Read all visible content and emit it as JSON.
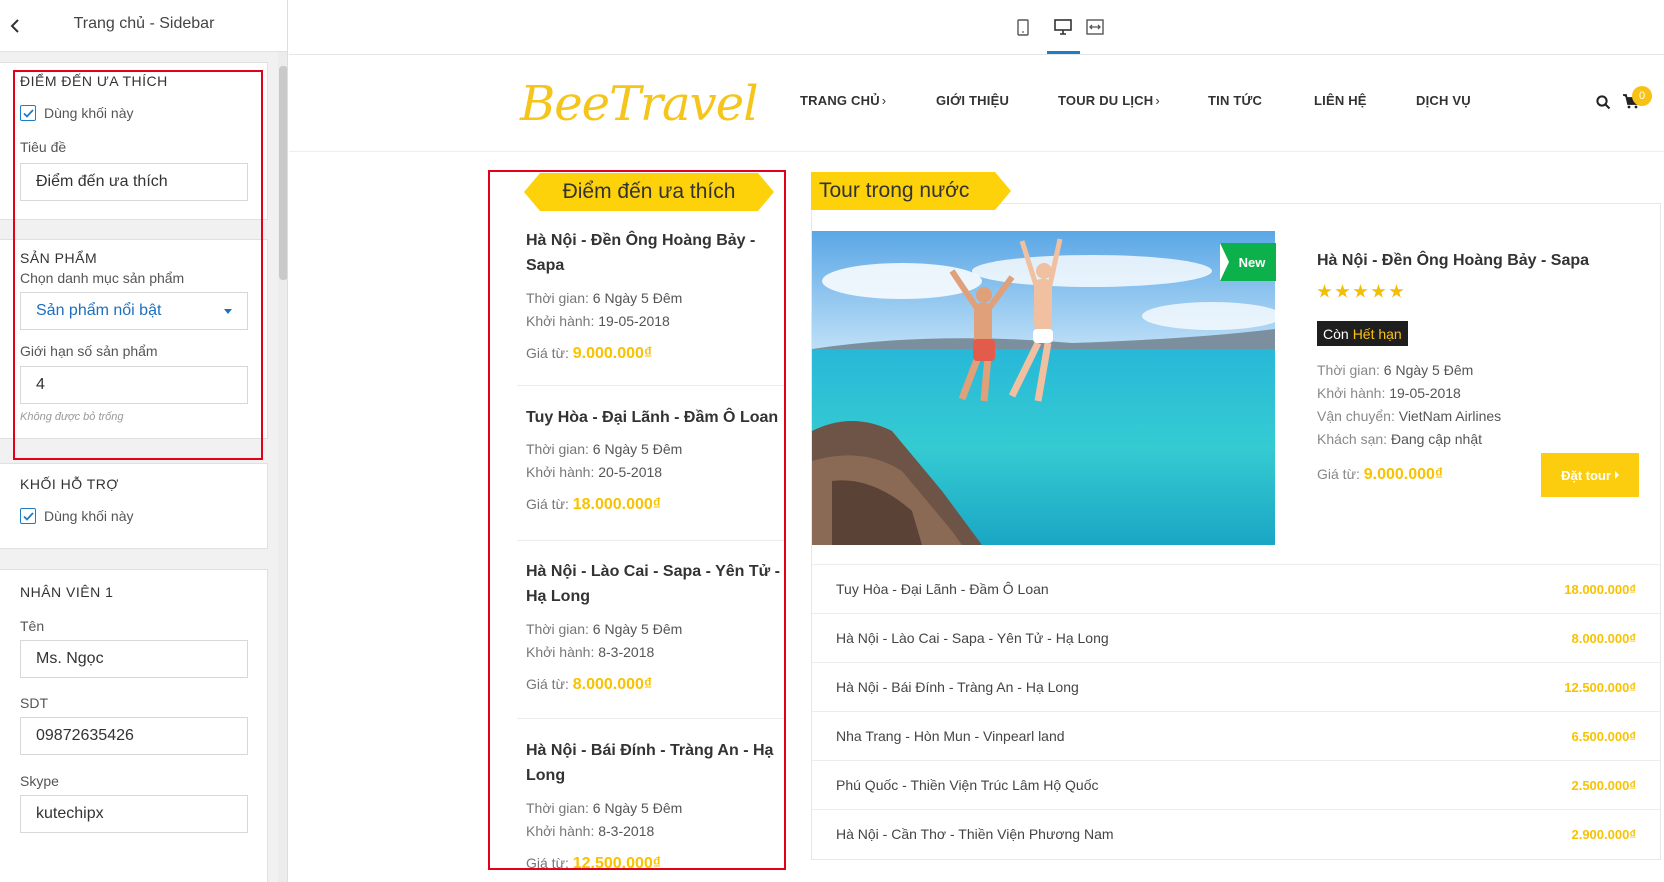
{
  "editor": {
    "title": "Trang chủ - Sidebar",
    "sections": {
      "favorite": {
        "title": "ĐIỂM ĐẾN ƯA THÍCH",
        "use_block_label": "Dùng khối này",
        "use_block_checked": true,
        "field_title_label": "Tiêu đề",
        "field_title_value": "Điểm đến ưa thích"
      },
      "products": {
        "title": "SẢN PHẨM",
        "category_label": "Chọn danh mục sản phẩm",
        "category_value": "Sản phẩm nổi bật",
        "limit_label": "Giới hạn số sản phẩm",
        "limit_value": "4",
        "limit_hint": "Không được bỏ trống"
      },
      "support": {
        "title": "KHỐI HỖ TRỢ",
        "use_block_label": "Dùng khối này",
        "use_block_checked": true
      },
      "staff": {
        "title": "NHÂN VIÊN 1",
        "name_label": "Tên",
        "name_value": "Ms. Ngọc",
        "phone_label": "SDT",
        "phone_value": "09872635426",
        "skype_label": "Skype",
        "skype_value": "kutechipx"
      }
    }
  },
  "preview_devices": [
    "mobile-icon",
    "desktop-icon",
    "fullwidth-icon"
  ],
  "site": {
    "logo": "BeeTravel",
    "nav": [
      {
        "label": "TRANG CHỦ",
        "has_sub": true
      },
      {
        "label": "GIỚI THIỆU",
        "has_sub": false
      },
      {
        "label": "TOUR DU LỊCH",
        "has_sub": true
      },
      {
        "label": "TIN TỨC",
        "has_sub": false
      },
      {
        "label": "LIÊN HỆ",
        "has_sub": false
      },
      {
        "label": "DỊCH VỤ",
        "has_sub": false
      }
    ],
    "cart_count": "0",
    "nav_chevron": "›"
  },
  "favorite_block": {
    "heading": "Điểm đến ưa thích",
    "time_label": "Thời gian:",
    "depart_label": "Khởi hành:",
    "price_label": "Giá từ:",
    "items": [
      {
        "title": "Hà Nội - Đền Ông Hoàng Bảy - Sapa",
        "time": "6 Ngày 5 Đêm",
        "depart": "19-05-2018",
        "price": "9.000.000₫"
      },
      {
        "title": "Tuy Hòa - Đại Lãnh - Đầm Ô Loan",
        "time": "6 Ngày 5 Đêm",
        "depart": "20-5-2018",
        "price": "18.000.000₫"
      },
      {
        "title": "Hà Nội - Lào Cai - Sapa - Yên Tử - Hạ Long",
        "time": "6 Ngày 5 Đêm",
        "depart": "8-3-2018",
        "price": "8.000.000₫"
      },
      {
        "title": "Hà Nội - Bái Đính - Tràng An - Hạ Long",
        "time": "6 Ngày 5 Đêm",
        "depart": "8-3-2018",
        "price": "12.500.000₫"
      }
    ]
  },
  "domestic": {
    "heading": "Tour trong nước",
    "featured": {
      "tag": "New",
      "title": "Hà Nội - Đền Ông Hoàng Bảy - Sapa",
      "rating": 5,
      "status_prefix": "Còn",
      "status_value": "Hết hạn",
      "time_label": "Thời gian:",
      "time": "6 Ngày 5 Đêm",
      "depart_label": "Khởi hành:",
      "depart": "19-05-2018",
      "transport_label": "Vận chuyển:",
      "transport": "VietNam Airlines",
      "hotel_label": "Khách sạn:",
      "hotel": "Đang cập nhật",
      "price_label": "Giá từ:",
      "price": "9.000.000₫",
      "book_label": "Đặt tour"
    },
    "list": [
      {
        "name": "Tuy Hòa - Đại Lãnh - Đầm Ô Loan",
        "price": "18.000.000₫"
      },
      {
        "name": "Hà Nội - Lào Cai - Sapa - Yên Tử - Hạ Long",
        "price": "8.000.000₫"
      },
      {
        "name": "Hà Nội - Bái Đính - Tràng An - Hạ Long",
        "price": "12.500.000₫"
      },
      {
        "name": "Nha Trang - Hòn Mun - Vinpearl land",
        "price": "6.500.000₫"
      },
      {
        "name": "Phú Quốc - Thiền Viện Trúc Lâm Hộ Quốc",
        "price": "2.500.000₫"
      },
      {
        "name": "Hà Nội - Cần Thơ - Thiền Viện Phương Nam",
        "price": "2.900.000₫"
      }
    ]
  },
  "colors": {
    "accent_yellow": "#fdd20b",
    "price_yellow": "#f8c200",
    "new_green": "#0db14b",
    "highlight_red": "#e3001b",
    "editor_blue": "#1e7dc7"
  }
}
